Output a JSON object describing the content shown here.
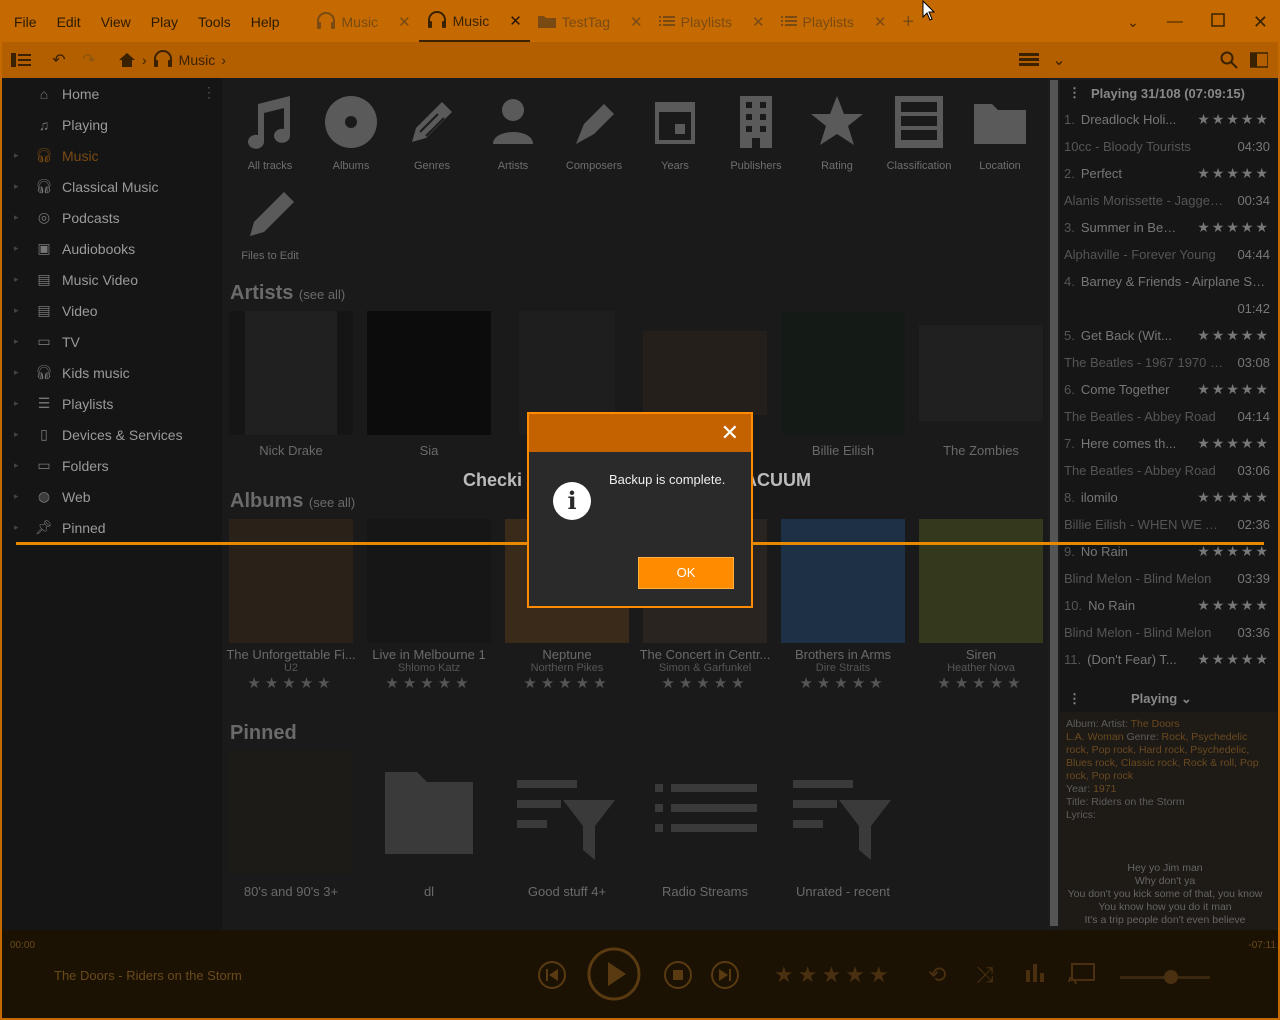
{
  "menu": [
    "File",
    "Edit",
    "View",
    "Play",
    "Tools",
    "Help"
  ],
  "tabs": [
    {
      "label": "Music",
      "icon": "headphones-icon"
    },
    {
      "label": "Music",
      "icon": "headphones-icon",
      "active": true
    },
    {
      "label": "TestTag",
      "icon": "folder-icon"
    },
    {
      "label": "Playlists",
      "icon": "list-icon"
    },
    {
      "label": "Playlists",
      "icon": "list-icon"
    }
  ],
  "toolbar": {
    "breadcrumb": "Music"
  },
  "sidebar": [
    {
      "label": "Home",
      "icon": "home-icon"
    },
    {
      "label": "Playing",
      "icon": "note-icon"
    },
    {
      "label": "Music",
      "icon": "headphones-icon",
      "active": true
    },
    {
      "label": "Classical Music",
      "icon": "headphones-icon"
    },
    {
      "label": "Podcasts",
      "icon": "podcast-icon"
    },
    {
      "label": "Audiobooks",
      "icon": "audiobook-icon"
    },
    {
      "label": "Music Video",
      "icon": "film-icon"
    },
    {
      "label": "Video",
      "icon": "film-icon"
    },
    {
      "label": "TV",
      "icon": "tv-icon"
    },
    {
      "label": "Kids music",
      "icon": "headphones-icon"
    },
    {
      "label": "Playlists",
      "icon": "list-icon"
    },
    {
      "label": "Devices & Services",
      "icon": "device-icon"
    },
    {
      "label": "Folders",
      "icon": "laptop-icon"
    },
    {
      "label": "Web",
      "icon": "globe-icon"
    },
    {
      "label": "Pinned",
      "icon": "pin-icon"
    }
  ],
  "categories": [
    "All tracks",
    "Albums",
    "Genres",
    "Artists",
    "Composers",
    "Years",
    "Publishers",
    "Rating",
    "Classification",
    "Location",
    "Files to Edit"
  ],
  "artists_section": {
    "title": "Artists",
    "see_all": "(see all)"
  },
  "artists": [
    "Nick Drake",
    "Sia",
    "",
    "",
    "Billie Eilish",
    "The Zombies"
  ],
  "albums_section": {
    "title": "Albums",
    "see_all": "(see all)"
  },
  "albums": [
    {
      "title": "The Unforgettable Fi...",
      "artist": "U2"
    },
    {
      "title": "Live in Melbourne 1",
      "artist": "Shlomo Katz"
    },
    {
      "title": "Neptune",
      "artist": "Northern Pikes"
    },
    {
      "title": "The Concert in Centr...",
      "artist": "Simon & Garfunkel"
    },
    {
      "title": "Brothers in Arms",
      "artist": "Dire Straits"
    },
    {
      "title": "Siren",
      "artist": "Heather Nova"
    }
  ],
  "pinned_section": {
    "title": "Pinned"
  },
  "pinned": [
    "80's and 90's 3+",
    "dl",
    "Good stuff 4+",
    "Radio Streams",
    "Unrated - recent"
  ],
  "now_playing": {
    "header": "Playing 31/108 (07:09:15)"
  },
  "playlist": [
    {
      "num": "1.",
      "title": "Dreadlock Holi...",
      "sub": "10cc - Bloody Tourists",
      "dur": "04:30"
    },
    {
      "num": "2.",
      "title": "Perfect",
      "sub": "Alanis Morissette - Jagged...",
      "dur": "00:34"
    },
    {
      "num": "3.",
      "title": "Summer in Ber...",
      "sub": "Alphaville - Forever Young",
      "dur": "04:44"
    },
    {
      "num": "4.",
      "title": "Barney & Friends - Airplane Son...",
      "sub": "",
      "dur": "01:42"
    },
    {
      "num": "5.",
      "title": "Get Back (Wit...",
      "sub": "The Beatles - 1967 1970 Bl...",
      "dur": "03:08"
    },
    {
      "num": "6.",
      "title": "Come Together",
      "sub": "The Beatles - Abbey Road",
      "dur": "04:14"
    },
    {
      "num": "7.",
      "title": "Here comes th...",
      "sub": "The Beatles - Abbey Road",
      "dur": "03:06"
    },
    {
      "num": "8.",
      "title": "ilomilo",
      "sub": "Billie Eilish - WHEN WE AL...",
      "dur": "02:36"
    },
    {
      "num": "9.",
      "title": "No Rain",
      "sub": "Blind Melon - Blind Melon",
      "dur": "03:39"
    },
    {
      "num": "10.",
      "title": "No Rain",
      "sub": "Blind Melon - Blind Melon",
      "dur": "03:36"
    },
    {
      "num": "11.",
      "title": "(Don't Fear) T...",
      "sub": "",
      "dur": ""
    }
  ],
  "info_panel": {
    "header": "Playing",
    "album_label": "Album:",
    "album_val": "L.A. Woman",
    "artist_label": "Artist:",
    "artist_val": "The Doors",
    "genre_label": "Genre:",
    "genre_val": "Rock, Psychedelic rock, Pop rock, Hard rock, Psychedelic, Blues rock, Classic rock, Rock & roll, Pop rock, Pop rock",
    "year_label": "Year:",
    "year_val": "1971",
    "title_label": "Title:",
    "title_val": "Riders on the Storm",
    "lyrics_label": "Lyrics:",
    "lyrics": [
      "Hey yo Jim man",
      "Why don't ya",
      "You don't you kick some of that, you know",
      "You know how you do it man",
      "It's a trip people don't even believe"
    ]
  },
  "player": {
    "elapsed": "00:00",
    "remaining": "-07:11",
    "track": "The Doors - Riders on the Storm"
  },
  "overlay": {
    "checking_left": "Checki",
    "checking_right": "ACUUM"
  },
  "dialog": {
    "message": "Backup is complete.",
    "ok": "OK",
    "close": "✕"
  }
}
